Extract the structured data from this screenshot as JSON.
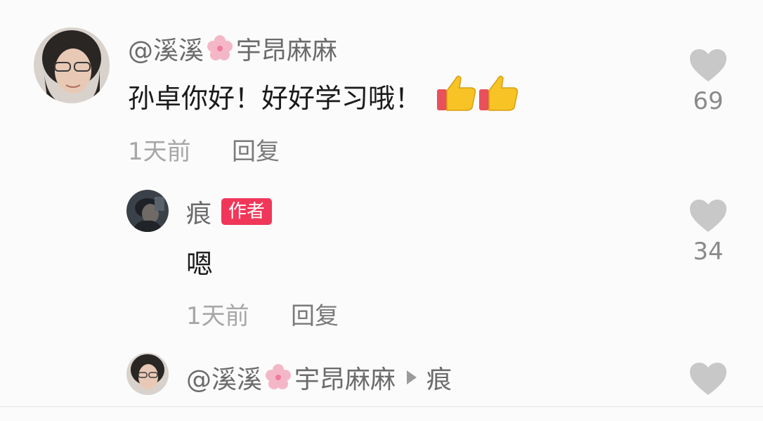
{
  "comment": {
    "username_prefix": "@溪溪",
    "username_suffix": "宇昂麻麻",
    "text": "孙卓你好！好好学习哦！",
    "time": "1天前",
    "reply_label": "回复",
    "likes": "69",
    "emoji_icon": "thumbs-up-icon"
  },
  "reply_1": {
    "username": "痕",
    "badge": "作者",
    "text": "嗯",
    "time": "1天前",
    "reply_label": "回复",
    "likes": "34"
  },
  "reply_2": {
    "username_prefix": "@溪溪",
    "username_suffix": "宇昂麻麻",
    "target": "痕"
  },
  "colors": {
    "badge": "#f0375a",
    "heart": "#c8c8c8",
    "username": "#6b6b6b"
  }
}
